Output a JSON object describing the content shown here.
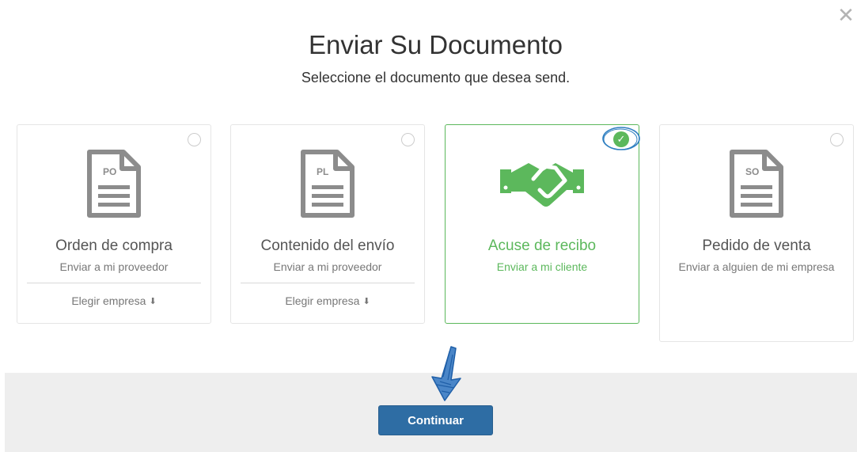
{
  "dialog": {
    "title": "Enviar Su Documento",
    "subtitle": "Seleccione el documento que desea send.",
    "close_icon": "close-x"
  },
  "colors": {
    "selected": "#5cb85c",
    "primary": "#2e6da4",
    "icon_gray": "#8c8c8c"
  },
  "cards": [
    {
      "code": "PO",
      "title": "Orden de compra",
      "subtitle": "Enviar a mi proveedor",
      "choose_label": "Elegir empresa",
      "chevron": "❯",
      "selected": false,
      "icon": "document-icon"
    },
    {
      "code": "PL",
      "title": "Contenido del envío",
      "subtitle": "Enviar a mi proveedor",
      "choose_label": "Elegir empresa",
      "chevron": "❯",
      "selected": false,
      "icon": "document-icon"
    },
    {
      "title": "Acuse de recibo",
      "subtitle": "Enviar a mi cliente",
      "selected": true,
      "icon": "handshake-icon"
    },
    {
      "code": "SO",
      "title": "Pedido de venta",
      "subtitle": "Enviar a alguien de mi empresa",
      "selected": false,
      "icon": "document-icon"
    }
  ],
  "footer": {
    "continue_label": "Continuar"
  }
}
